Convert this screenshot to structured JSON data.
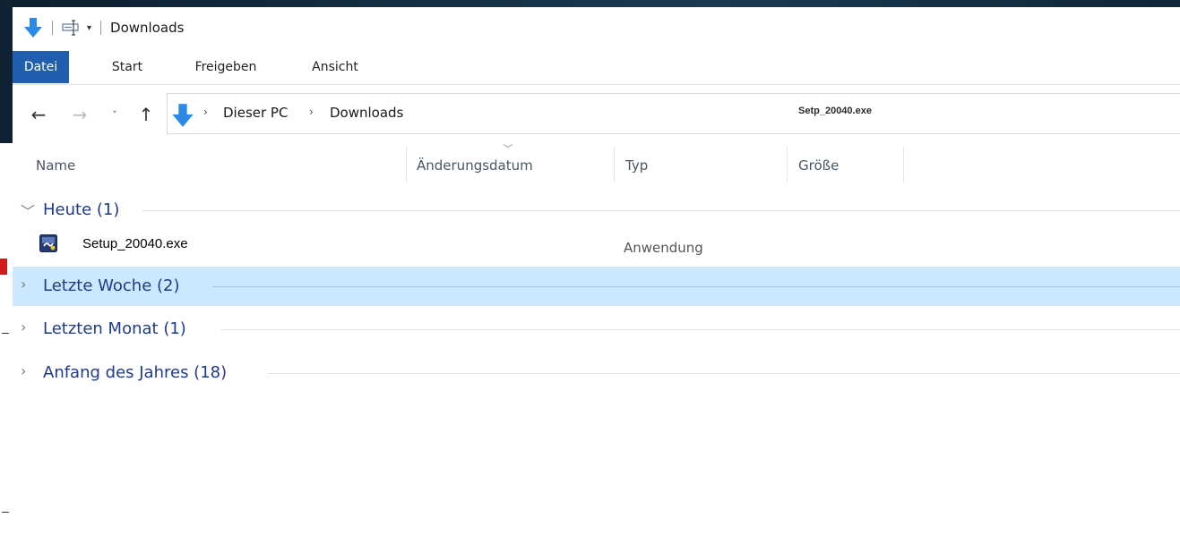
{
  "window": {
    "title": "Downloads"
  },
  "ribbon": {
    "tabs": [
      {
        "label": "Datei",
        "active": true
      },
      {
        "label": "Start"
      },
      {
        "label": "Freigeben"
      },
      {
        "label": "Ansicht"
      }
    ]
  },
  "address": {
    "crumbs": [
      "Dieser PC",
      "Downloads"
    ],
    "overlay_text": "Setp_20040.exe"
  },
  "columns": {
    "name": "Name",
    "date": "Änderungsdatum",
    "type": "Typ",
    "size": "Größe"
  },
  "groups": [
    {
      "title": "Heute (1)",
      "expanded": true
    },
    {
      "title": "Letzte Woche (2)",
      "expanded": false,
      "selected": true
    },
    {
      "title": "Letzten Monat (1)",
      "expanded": false
    },
    {
      "title": "Anfang des Jahres (18)",
      "expanded": false
    }
  ],
  "files": [
    {
      "name": "Setup_20040.exe",
      "type": "Anwendung",
      "icon": "installer-icon"
    }
  ],
  "colors": {
    "accent": "#1f5fad",
    "group_text": "#1e3a8a",
    "selection": "#cce8ff",
    "download_arrow": "#2b8ae6"
  }
}
